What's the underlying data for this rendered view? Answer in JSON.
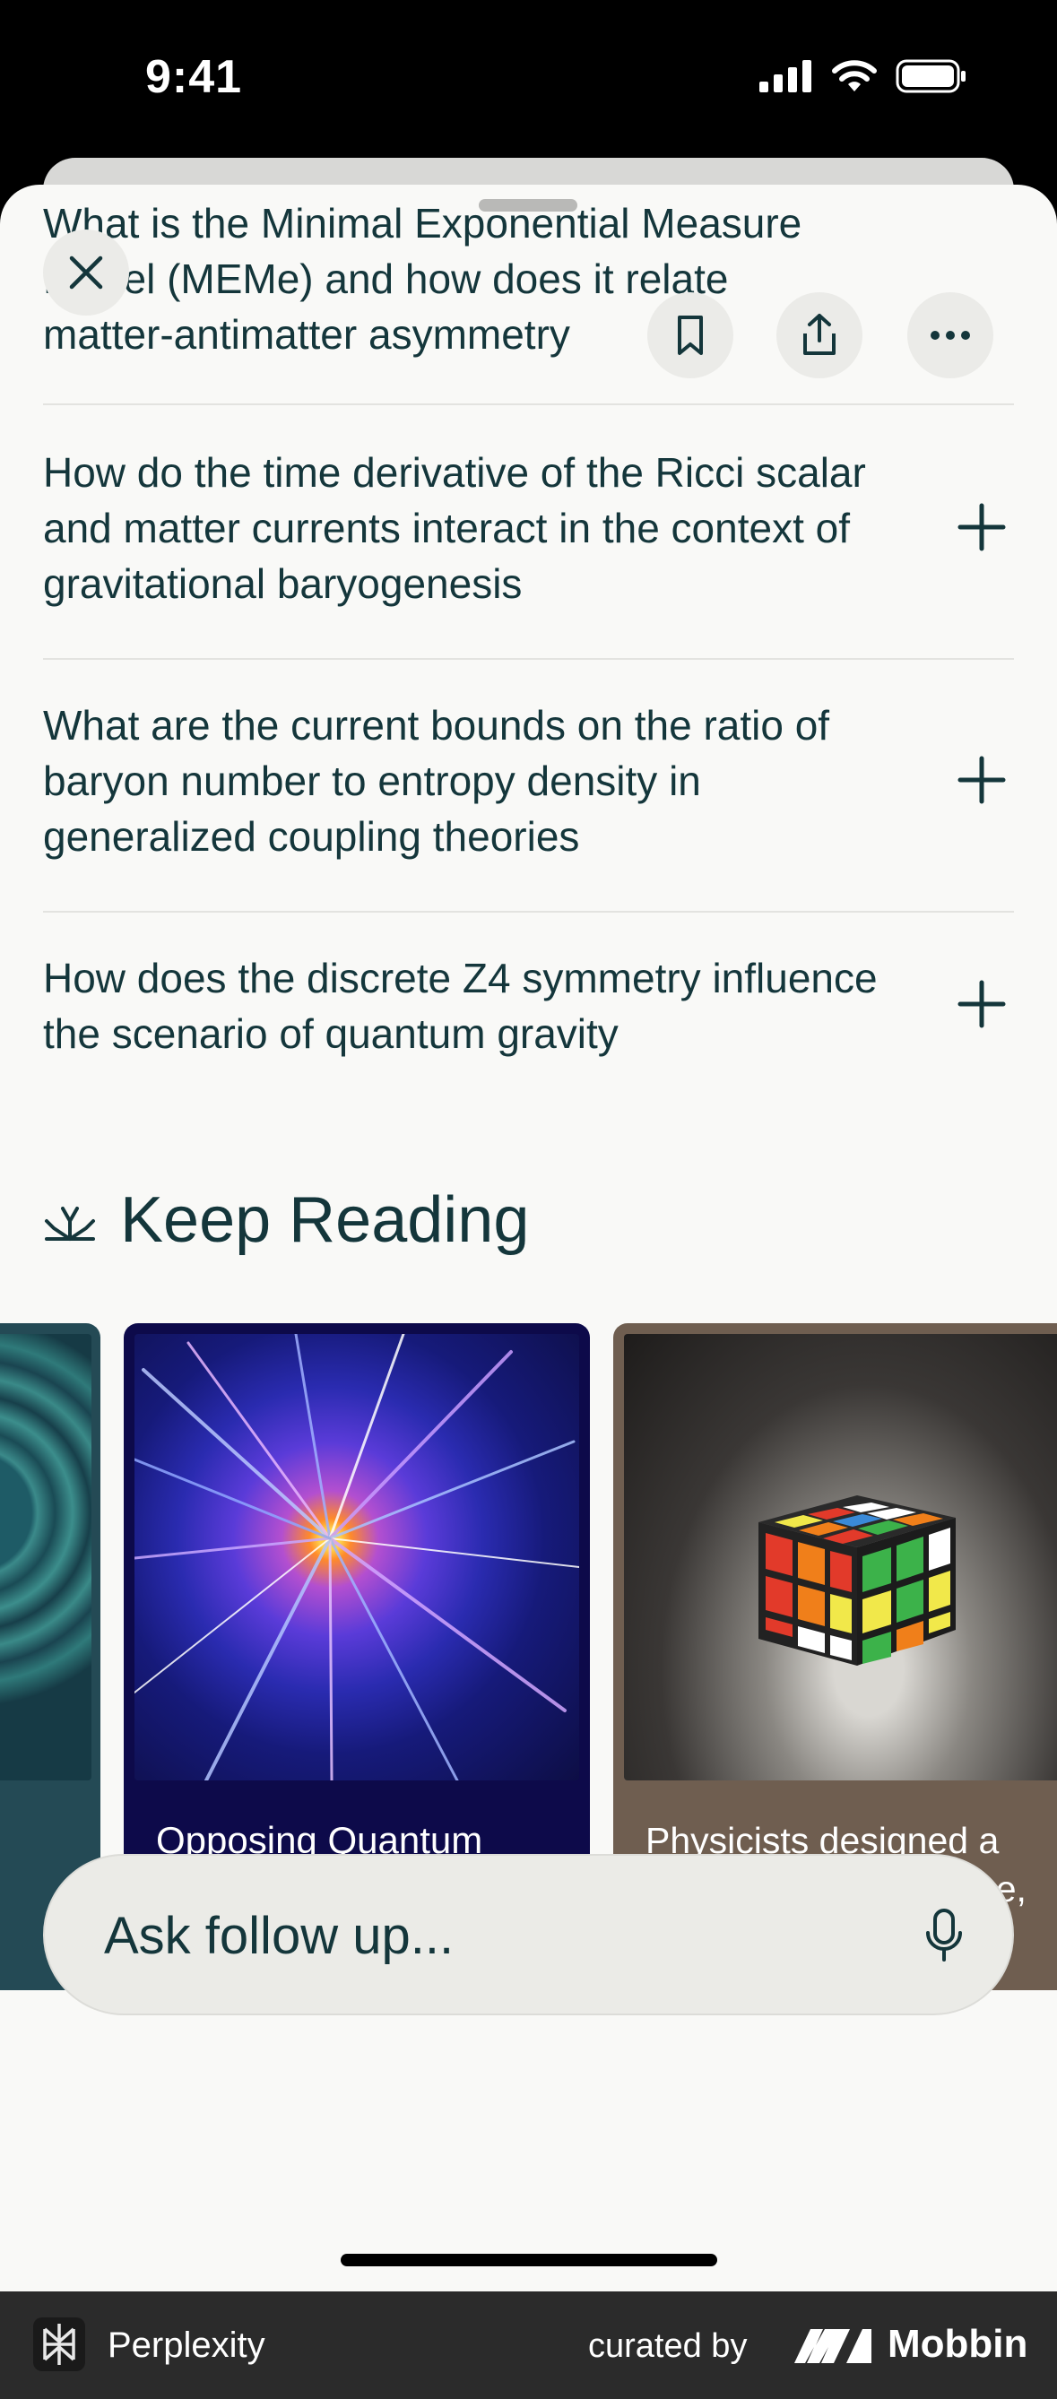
{
  "status_bar": {
    "time": "9:41"
  },
  "header_question": {
    "line1": "What is the Minimal Exponential Measure",
    "line2_prefix": "Model (MEMe) and how does it relate",
    "line3": "matter-antimatter asymmetry"
  },
  "related_questions": [
    {
      "text": "How do the time derivative of the Ricci scalar and matter currents interact in the context of gravitational baryogenesis"
    },
    {
      "text": "What are the current bounds on the ratio of baryon number to entropy density in generalized coupling theories"
    },
    {
      "text": "How does the discrete Z4 symmetry influence the scenario of quantum gravity"
    }
  ],
  "keep_reading": {
    "title": "Keep Reading",
    "cards": [
      {
        "caption": "Opposing Quantum Arrows of Time Observed"
      },
      {
        "caption": "Physicists designed a quantum Rubik's Cube, then discovere..."
      }
    ]
  },
  "ask": {
    "placeholder": "Ask follow up..."
  },
  "footer": {
    "brand": "Perplexity",
    "curated_by": "curated by",
    "mobbin": "Mobbin"
  },
  "colors": {
    "text": "#14363b",
    "sheet_bg": "#f9f9f7",
    "card_blue": "#0d0a4a",
    "card_brown": "#6f5e50"
  },
  "icons": [
    "close-icon",
    "bookmark-icon",
    "share-icon",
    "more-icon",
    "plus-icon",
    "sparkle-icon",
    "mic-icon"
  ]
}
